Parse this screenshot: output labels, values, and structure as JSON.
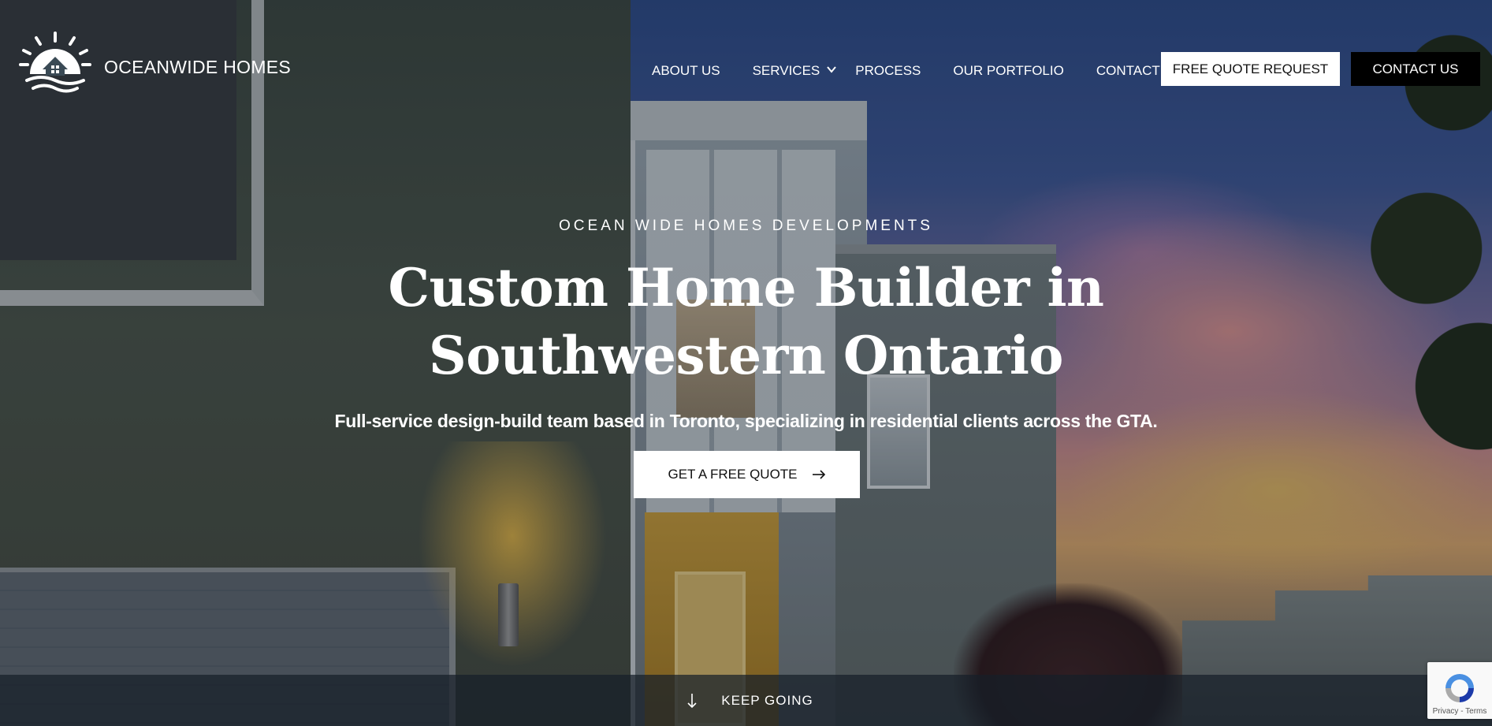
{
  "brand": {
    "name": "OCEANWIDE HOMES",
    "logo_icon": "house-sun-waves-logo"
  },
  "nav": {
    "items": [
      {
        "label": "ABOUT US"
      },
      {
        "label": "SERVICES",
        "icon": "chevron-down-icon"
      },
      {
        "label": "PROCESS"
      },
      {
        "label": "OUR PORTFOLIO"
      },
      {
        "label": "CONTACT US"
      }
    ],
    "cta_quote_request": "FREE QUOTE REQUEST",
    "cta_contact": "CONTACT US"
  },
  "hero": {
    "eyebrow": "OCEAN WIDE HOMES DEVELOPMENTS",
    "headline_line1": "Custom Home Builder in",
    "headline_line2": "Southwestern Ontario",
    "subhead": "Full-service design-build team based in Toronto, specializing in residential clients across the GTA.",
    "cta_label": "GET A FREE QUOTE",
    "cta_icon": "arrow-right-icon"
  },
  "bottom_bar": {
    "label": "KEEP GOING",
    "icon": "arrow-down-icon"
  },
  "recaptcha": {
    "text": "Privacy - Terms"
  },
  "colors": {
    "primary_button_bg": "#ffffff",
    "contact_button_bg": "#000000",
    "text": "#ffffff"
  }
}
